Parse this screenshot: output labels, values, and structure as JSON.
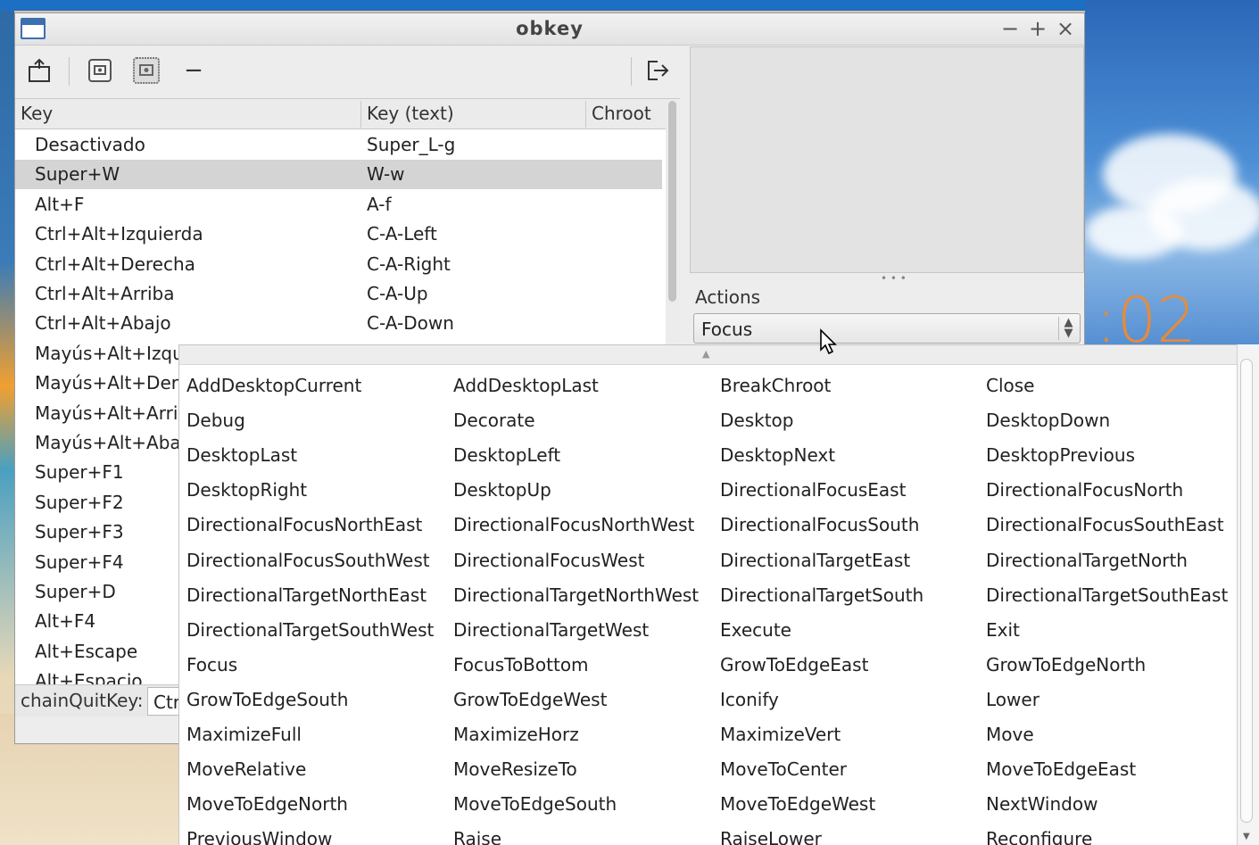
{
  "window": {
    "title": "obkey",
    "minimize": "−",
    "maximize": "+",
    "close": "×"
  },
  "toolbar": {
    "dash": "−"
  },
  "table": {
    "columns": [
      "Key",
      "Key (text)",
      "Chroot"
    ],
    "rows": [
      {
        "key": "Desactivado",
        "text": "Super_L-g"
      },
      {
        "key": "Super+W",
        "text": "W-w"
      },
      {
        "key": "Alt+F",
        "text": "A-f"
      },
      {
        "key": "Ctrl+Alt+Izquierda",
        "text": "C-A-Left"
      },
      {
        "key": "Ctrl+Alt+Derecha",
        "text": "C-A-Right"
      },
      {
        "key": "Ctrl+Alt+Arriba",
        "text": "C-A-Up"
      },
      {
        "key": "Ctrl+Alt+Abajo",
        "text": "C-A-Down"
      },
      {
        "key": "Mayús+Alt+Izqui",
        "text": ""
      },
      {
        "key": "Mayús+Alt+Dere",
        "text": ""
      },
      {
        "key": "Mayús+Alt+Arrib",
        "text": ""
      },
      {
        "key": "Mayús+Alt+Abaj",
        "text": ""
      },
      {
        "key": "Super+F1",
        "text": ""
      },
      {
        "key": "Super+F2",
        "text": ""
      },
      {
        "key": "Super+F3",
        "text": ""
      },
      {
        "key": "Super+F4",
        "text": ""
      },
      {
        "key": "Super+D",
        "text": ""
      },
      {
        "key": "Alt+F4",
        "text": ""
      },
      {
        "key": "Alt+Escape",
        "text": ""
      },
      {
        "key": "Alt+Espacio",
        "text": ""
      }
    ],
    "selected_index": 1
  },
  "chain": {
    "label": "chainQuitKey:",
    "value": "Ctrl"
  },
  "actions": {
    "label": "Actions",
    "selected": "Focus",
    "arrows": "⌃⌄"
  },
  "desktop": {
    "clock": ":02"
  },
  "action_options": [
    [
      "AddDesktopCurrent",
      "AddDesktopLast",
      "BreakChroot",
      "Close"
    ],
    [
      "Debug",
      "Decorate",
      "Desktop",
      "DesktopDown"
    ],
    [
      "DesktopLast",
      "DesktopLeft",
      "DesktopNext",
      "DesktopPrevious"
    ],
    [
      "DesktopRight",
      "DesktopUp",
      "DirectionalFocusEast",
      "DirectionalFocusNorth"
    ],
    [
      "DirectionalFocusNorthEast",
      "DirectionalFocusNorthWest",
      "DirectionalFocusSouth",
      "DirectionalFocusSouthEast"
    ],
    [
      "DirectionalFocusSouthWest",
      "DirectionalFocusWest",
      "DirectionalTargetEast",
      "DirectionalTargetNorth"
    ],
    [
      "DirectionalTargetNorthEast",
      "DirectionalTargetNorthWest",
      "DirectionalTargetSouth",
      "DirectionalTargetSouthEast"
    ],
    [
      "DirectionalTargetSouthWest",
      "DirectionalTargetWest",
      "Execute",
      "Exit"
    ],
    [
      "Focus",
      "FocusToBottom",
      "GrowToEdgeEast",
      "GrowToEdgeNorth"
    ],
    [
      "GrowToEdgeSouth",
      "GrowToEdgeWest",
      "Iconify",
      "Lower"
    ],
    [
      "MaximizeFull",
      "MaximizeHorz",
      "MaximizeVert",
      "Move"
    ],
    [
      "MoveRelative",
      "MoveResizeTo",
      "MoveToCenter",
      "MoveToEdgeEast"
    ],
    [
      "MoveToEdgeNorth",
      "MoveToEdgeSouth",
      "MoveToEdgeWest",
      "NextWindow"
    ],
    [
      "PreviousWindow",
      "Raise",
      "RaiseLower",
      "Reconfigure"
    ]
  ]
}
